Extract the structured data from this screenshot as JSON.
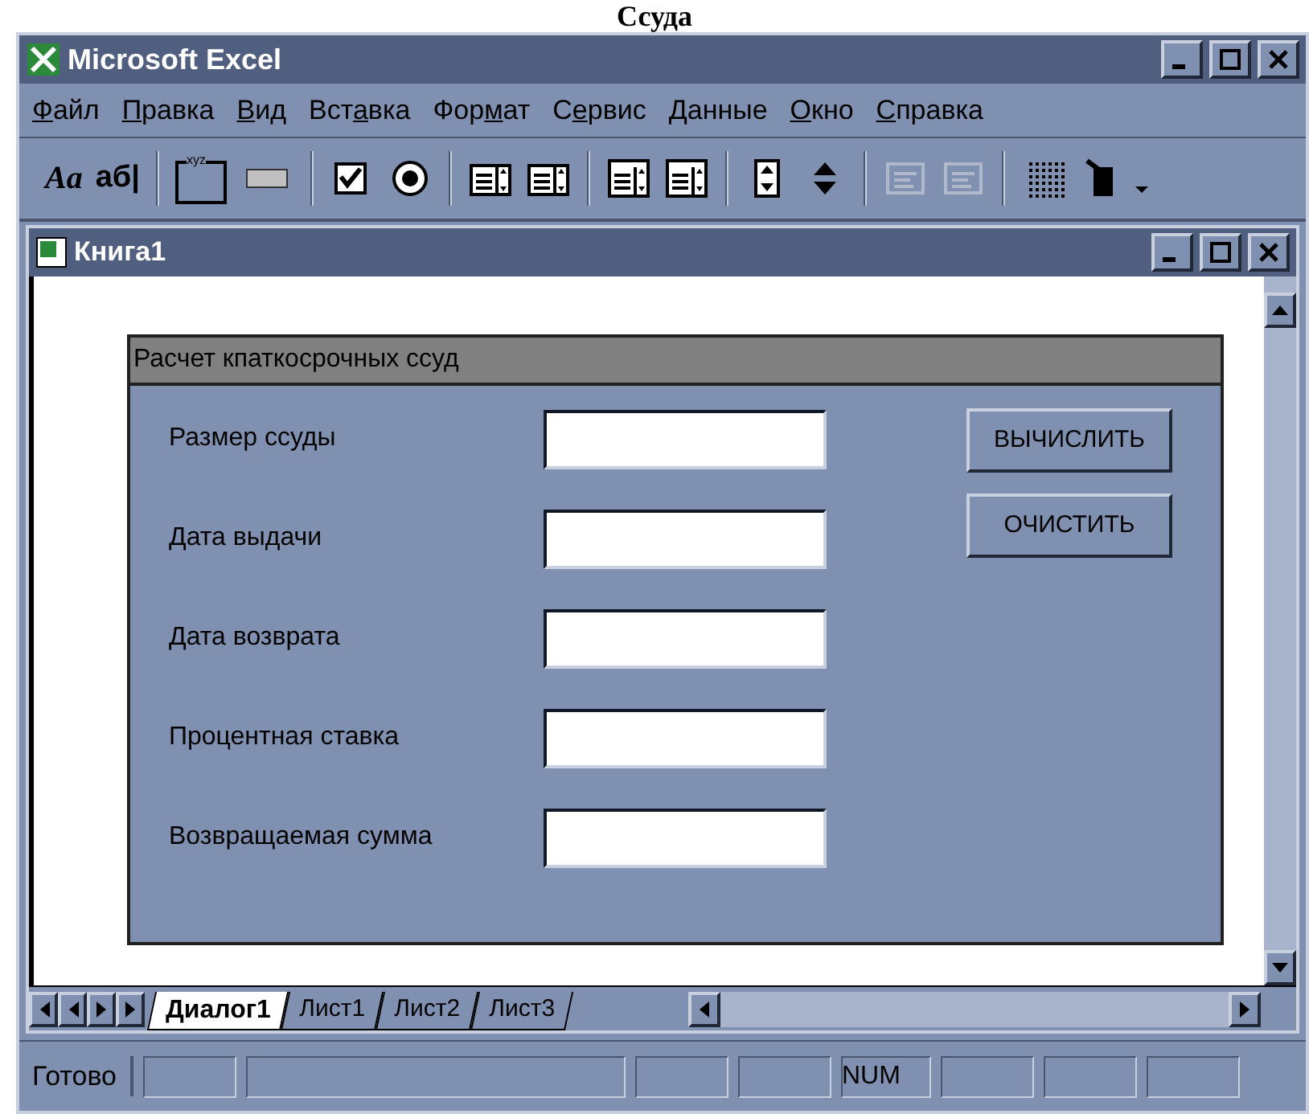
{
  "caption": "Ссуда",
  "window": {
    "title": "Microsoft Excel"
  },
  "menu": [
    {
      "key": "Ф",
      "post": "айл"
    },
    {
      "key": "П",
      "post": "равка"
    },
    {
      "key": "В",
      "post": "ид"
    },
    {
      "pre": "Вст",
      "key": "а",
      "post": "вка"
    },
    {
      "pre": "Фор",
      "key": "м",
      "post": "ат"
    },
    {
      "pre": "С",
      "key": "е",
      "post": "рвис"
    },
    {
      "key": "Д",
      "post": "анные"
    },
    {
      "key": "О",
      "post": "кно"
    },
    {
      "key": "С",
      "post": "правка"
    }
  ],
  "toolbar": [
    {
      "kind": "label",
      "text": "Aa"
    },
    {
      "kind": "edit",
      "text": "аб|"
    },
    {
      "kind": "sep"
    },
    {
      "kind": "group",
      "text": "xyz"
    },
    {
      "kind": "button"
    },
    {
      "kind": "sep"
    },
    {
      "kind": "checkbox"
    },
    {
      "kind": "radio"
    },
    {
      "kind": "sep"
    },
    {
      "kind": "list"
    },
    {
      "kind": "listdrop"
    },
    {
      "kind": "sep"
    },
    {
      "kind": "combolist"
    },
    {
      "kind": "combodrop"
    },
    {
      "kind": "sep"
    },
    {
      "kind": "spinner"
    },
    {
      "kind": "updown"
    },
    {
      "kind": "sep"
    },
    {
      "kind": "props",
      "disabled": true
    },
    {
      "kind": "code",
      "disabled": true
    },
    {
      "kind": "sep"
    },
    {
      "kind": "grid"
    },
    {
      "kind": "run"
    },
    {
      "kind": "more"
    }
  ],
  "workbook": {
    "title": "Книга1"
  },
  "dialog": {
    "title": "Расчет кпаткосрочных ссуд",
    "fields": [
      {
        "label": "Размер ссуды"
      },
      {
        "label": "Дата выдачи"
      },
      {
        "label": "Дата возврата"
      },
      {
        "label": "Процентная ставка"
      },
      {
        "label": "Возвращаемая сумма"
      }
    ],
    "buttons": [
      "ВЫЧИСЛИТЬ",
      "ОЧИСТИТЬ"
    ]
  },
  "sheet_tabs": [
    {
      "label": "Диалог1",
      "selected": true
    },
    {
      "label": "Лист1",
      "selected": false
    },
    {
      "label": "Лист2",
      "selected": false
    },
    {
      "label": "Лист3",
      "selected": false
    }
  ],
  "status_bar": {
    "text": "Готово",
    "panels": [
      {
        "kind": "empty"
      },
      {
        "kind": "wide"
      },
      {
        "kind": "empty"
      },
      {
        "kind": "empty"
      },
      {
        "kind": "text",
        "text": "NUM"
      },
      {
        "kind": "empty"
      },
      {
        "kind": "empty"
      },
      {
        "kind": "empty"
      }
    ]
  }
}
